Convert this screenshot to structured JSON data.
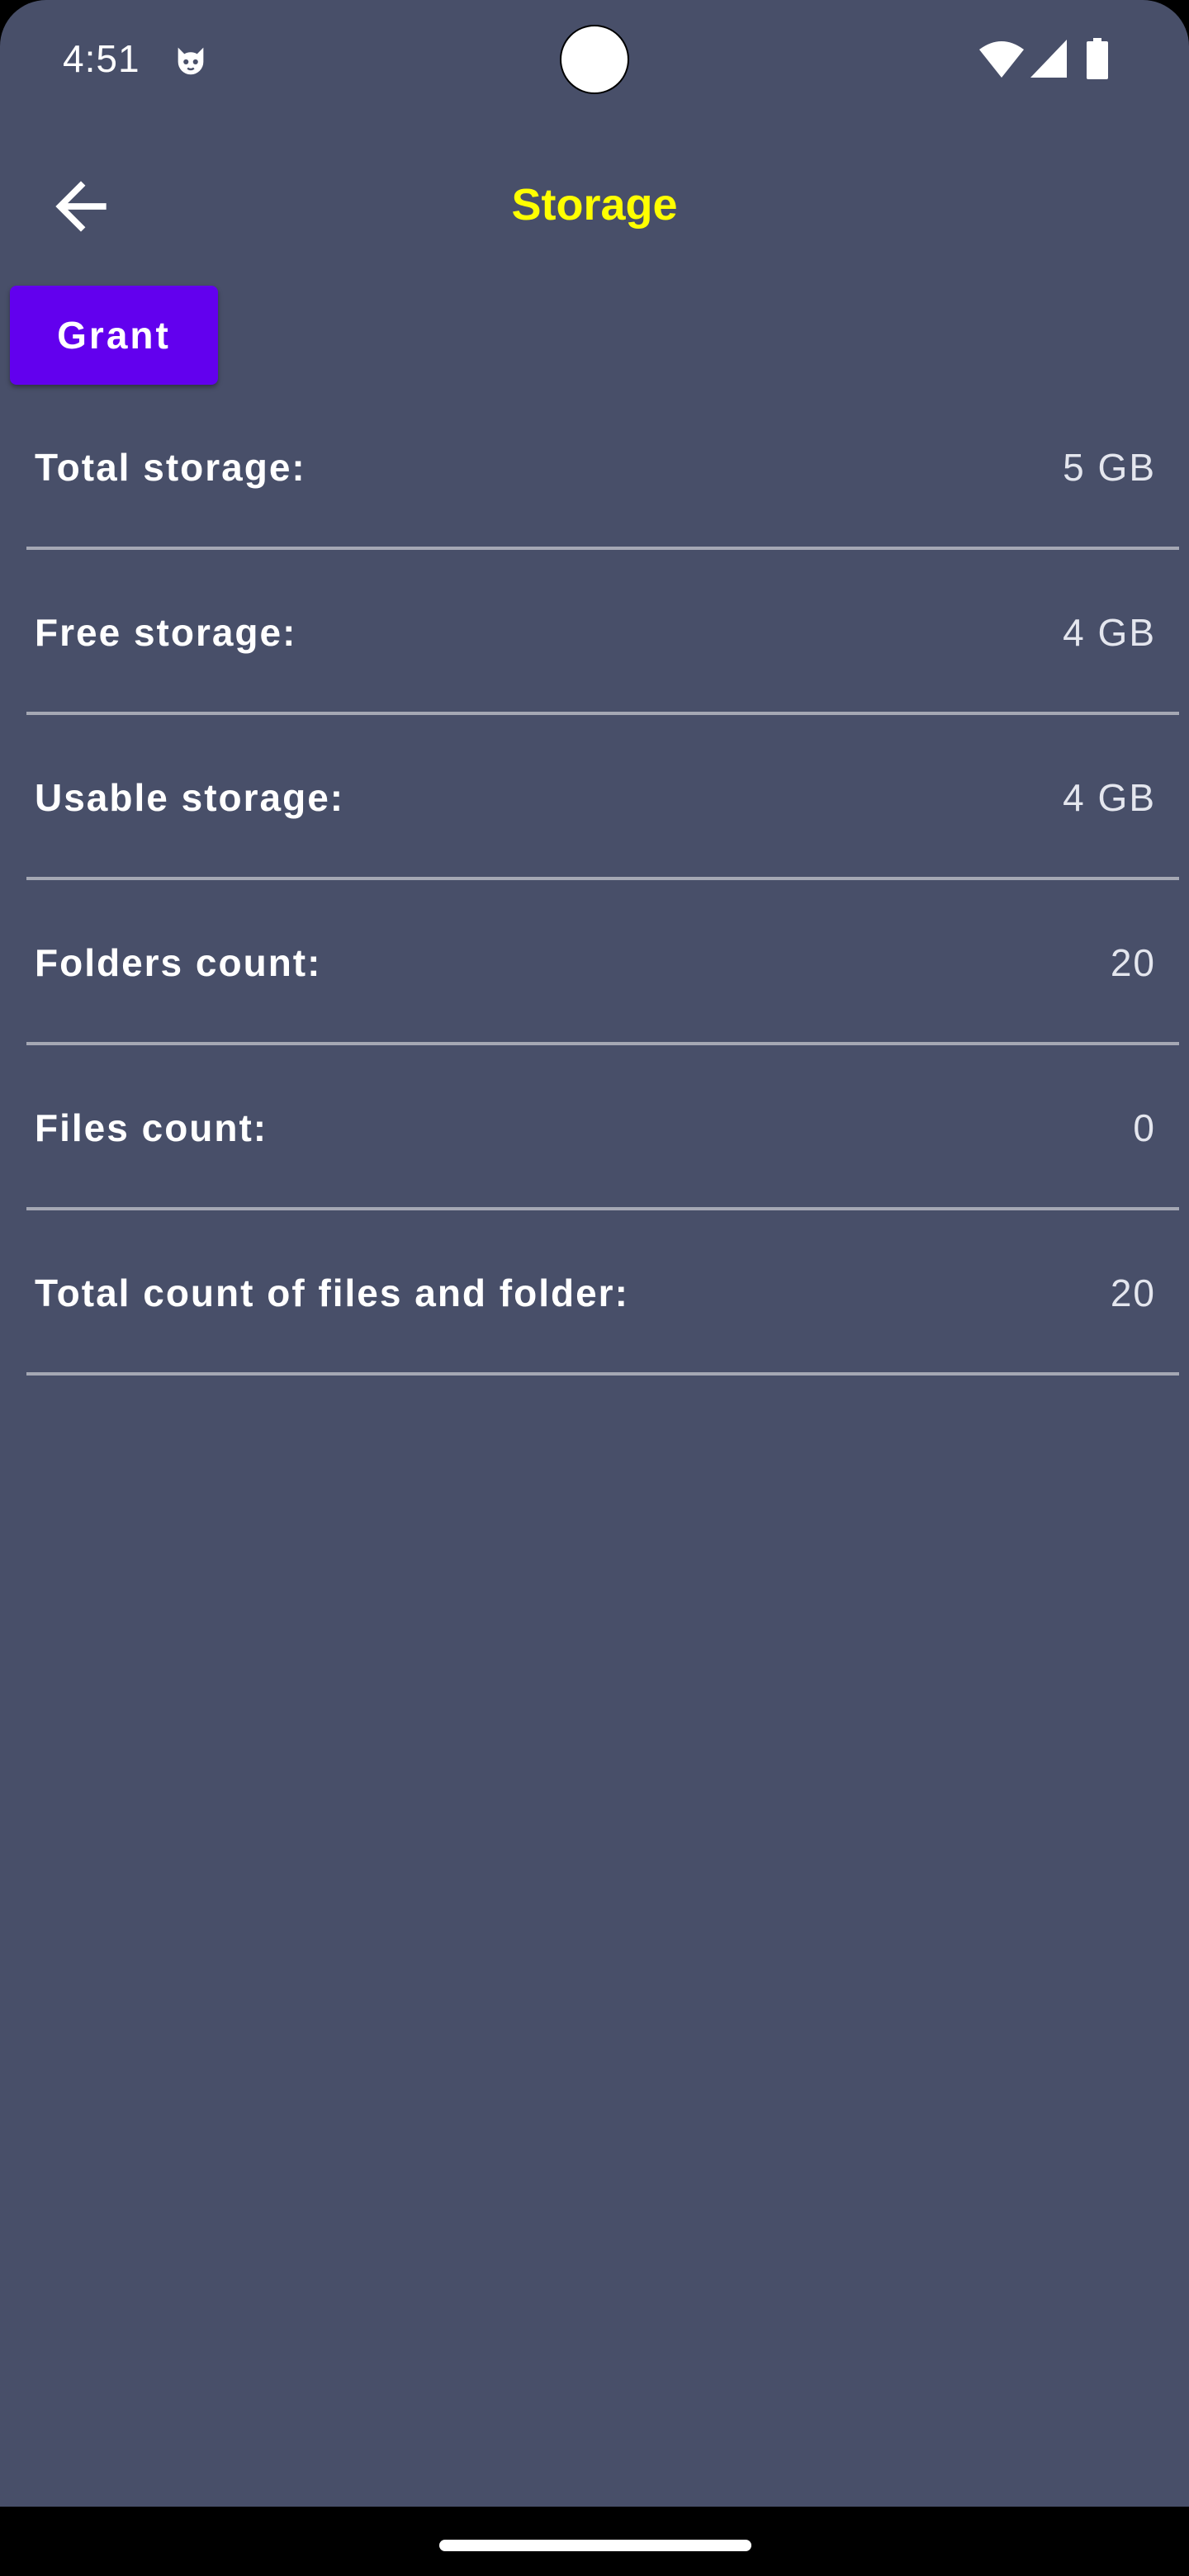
{
  "status_bar": {
    "time": "4:51",
    "app_icon": "android-cat-icon",
    "wifi_icon": "wifi-icon",
    "signal_icon": "cell-signal-icon",
    "battery_icon": "battery-icon"
  },
  "app_bar": {
    "title": "Storage",
    "title_color": "#ffff00",
    "back_icon": "arrow-left-icon"
  },
  "grant_button": {
    "label": "Grant",
    "color": "#6200ee"
  },
  "storage_info": [
    {
      "label": "Total storage:",
      "value": "5 GB"
    },
    {
      "label": "Free storage:",
      "value": "4 GB"
    },
    {
      "label": "Usable storage:",
      "value": "4 GB"
    },
    {
      "label": "Folders count:",
      "value": "20"
    },
    {
      "label": "Files count:",
      "value": "0"
    },
    {
      "label": "Total count of files and folder:",
      "value": "20"
    }
  ],
  "theme": {
    "background": "#484f69",
    "divider": "#a5a8b4"
  }
}
